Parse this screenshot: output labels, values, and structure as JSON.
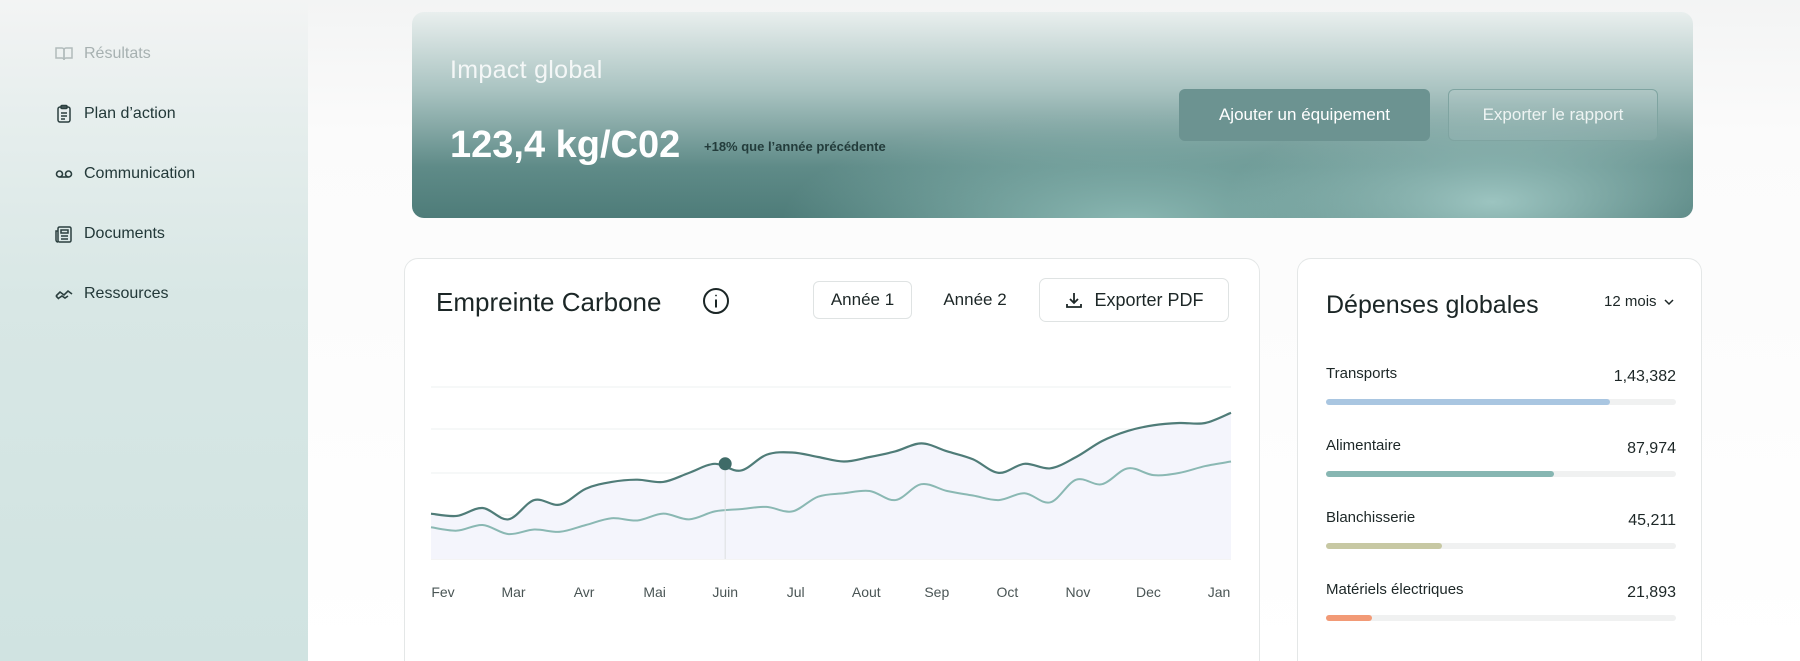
{
  "sidebar": {
    "items": [
      {
        "label": "Résultats",
        "icon": "book-open-icon",
        "dim": true
      },
      {
        "label": "Plan d’action",
        "icon": "clipboard-icon",
        "dim": false
      },
      {
        "label": "Communication",
        "icon": "voicemail-icon",
        "dim": false
      },
      {
        "label": "Documents",
        "icon": "newspaper-icon",
        "dim": false
      },
      {
        "label": "Ressources",
        "icon": "handshake-icon",
        "dim": false
      }
    ]
  },
  "hero": {
    "label": "Impact global",
    "value": "123,4 kg/C02",
    "change": "+18% que l’année précédente",
    "add_button": "Ajouter un équipement",
    "export_button": "Exporter le rapport"
  },
  "carbon": {
    "title": "Empreinte Carbone",
    "year1": "Année 1",
    "year2": "Année 2",
    "export_pdf": "Exporter PDF"
  },
  "chart_data": {
    "type": "line",
    "categories": [
      "Fev",
      "Mar",
      "Avr",
      "Mai",
      "Juin",
      "Jul",
      "Aout",
      "Sep",
      "Oct",
      "Nov",
      "Dec",
      "Jan"
    ],
    "series": [
      {
        "values": [
          40,
          38,
          45,
          35,
          52,
          48,
          62,
          68,
          70,
          68,
          76,
          84,
          78,
          92,
          94,
          90,
          86,
          90,
          95,
          102,
          95,
          88,
          76,
          84,
          80,
          90,
          104,
          113,
          118,
          120,
          120,
          129
        ],
        "color": "#4f7c78"
      },
      {
        "values": [
          28,
          25,
          30,
          22,
          26,
          24,
          30,
          36,
          34,
          40,
          35,
          42,
          44,
          46,
          42,
          55,
          58,
          60,
          52,
          66,
          60,
          56,
          52,
          58,
          50,
          70,
          66,
          80,
          74,
          76,
          82,
          86
        ],
        "color": "#8ab8b3"
      }
    ],
    "highlight": {
      "category": "Juin",
      "series": 0
    },
    "grid": true
  },
  "expenses": {
    "title": "Dépenses globales",
    "period": "12 mois",
    "items": [
      {
        "name": "Transports",
        "value": "1,43,382",
        "fill": 0.81,
        "color": "#a9c6e1"
      },
      {
        "name": "Alimentaire",
        "value": "87,974",
        "fill": 0.65,
        "color": "#87b6b2"
      },
      {
        "name": "Blanchisserie",
        "value": "45,211",
        "fill": 0.33,
        "color": "#c7c8a3"
      },
      {
        "name": "Matériels électriques",
        "value": "21,893",
        "fill": 0.13,
        "color": "#f29a76"
      }
    ]
  }
}
